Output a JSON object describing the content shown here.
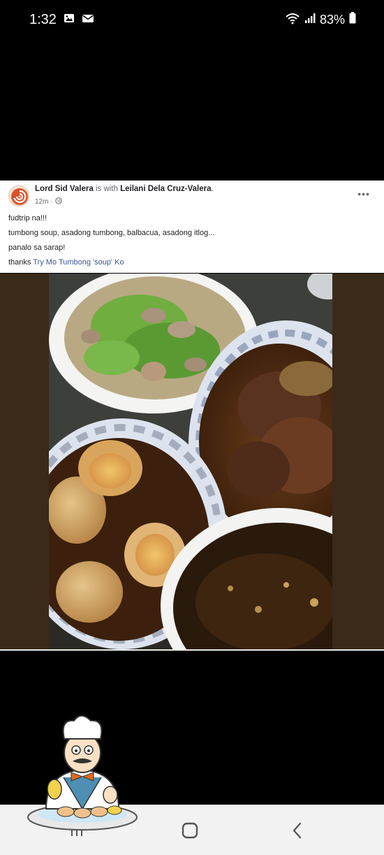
{
  "status_bar": {
    "time": "1:32",
    "battery": "83%",
    "icons": [
      "image-icon",
      "mail-icon",
      "wifi-icon",
      "signal-icon",
      "battery-icon"
    ]
  },
  "post": {
    "author": "Lord Sid Valera",
    "with_text": "is with",
    "tagged": "Leilani Dela Cruz-Valera",
    "tagged_suffix": ".",
    "time": "12m",
    "privacy_icon": "globe-icon",
    "lines": [
      "fudtrip na!!!",
      "tumbong soup, asadong tumbong, balbacua, asadong itlog...",
      "panalo sa sarap!"
    ],
    "thanks_prefix": "thanks",
    "thanks_link": "Try Mo Tumbong 'soup' Ko",
    "more_label": "•••"
  },
  "photo": {
    "subject": "food-photo",
    "dishes": [
      "soup-bowl",
      "meat-plate",
      "egg-plate",
      "broth-bowl"
    ]
  },
  "nav": {
    "icons": [
      "recents-icon",
      "home-icon",
      "back-icon"
    ]
  },
  "colors": {
    "card_bg": "#ffffff",
    "link": "#385898",
    "secondary_text": "#65676b",
    "photo_bg": "#3a2a1a"
  }
}
